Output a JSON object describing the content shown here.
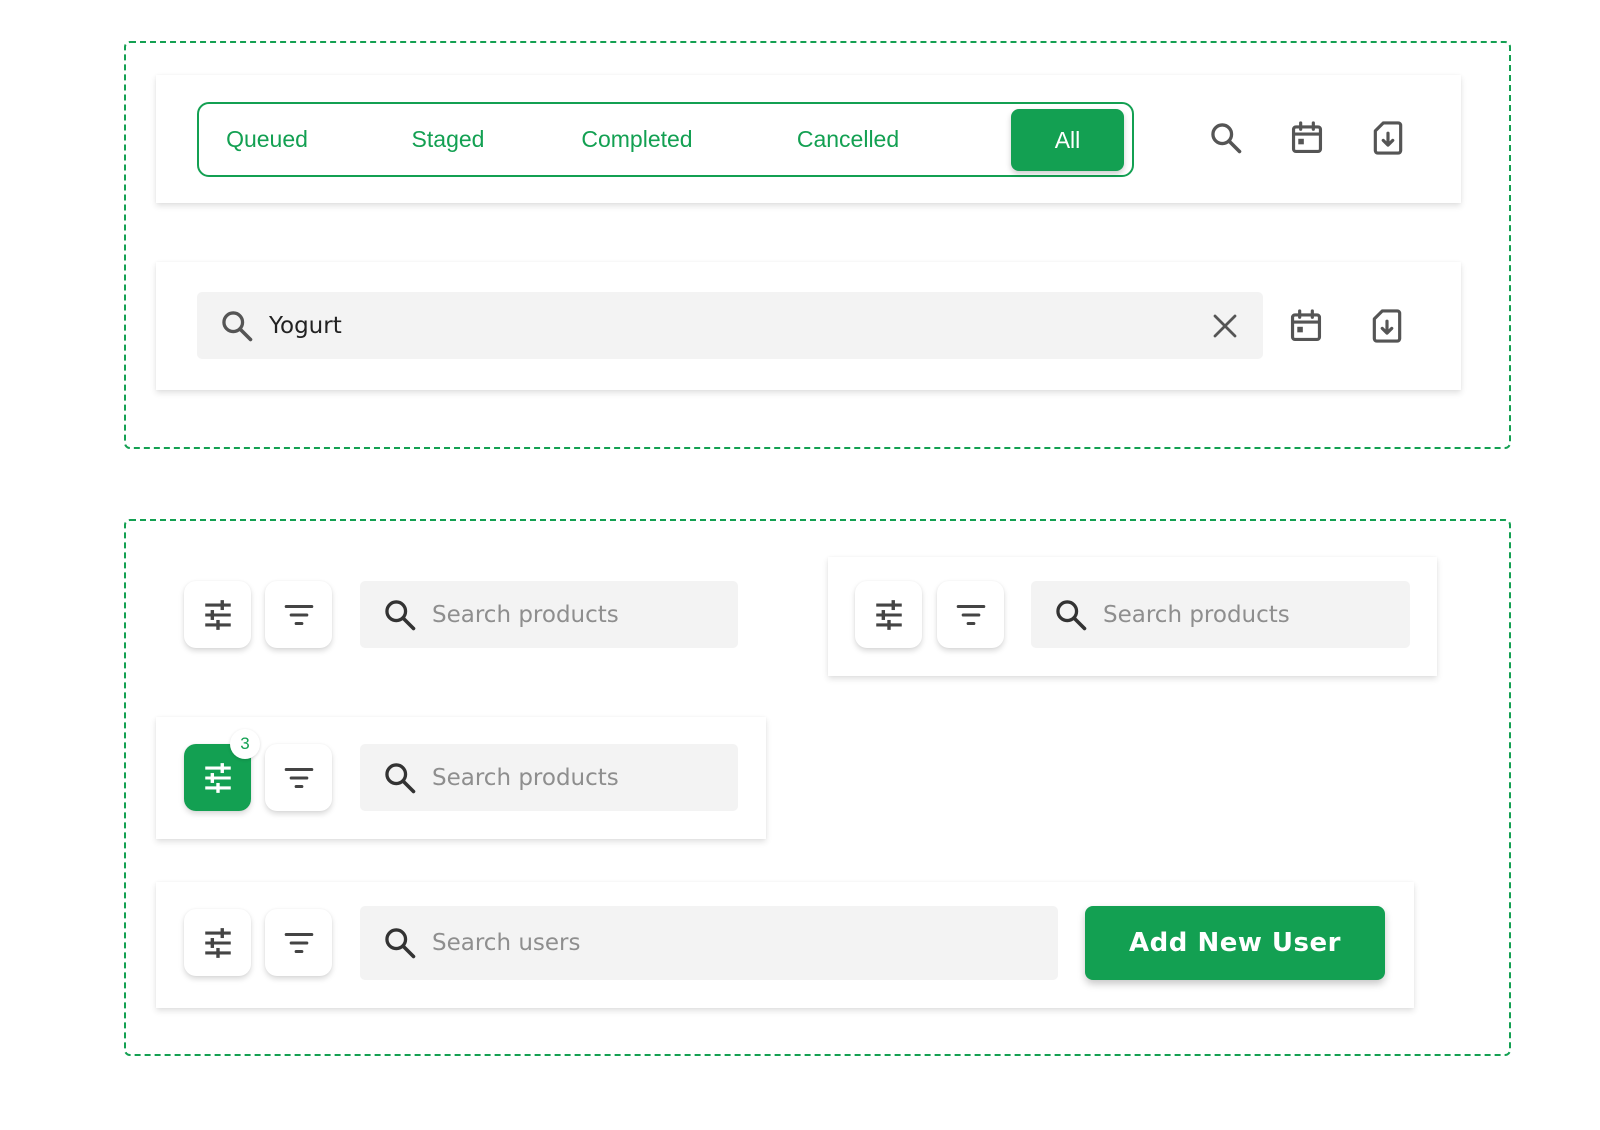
{
  "colors": {
    "accent": "#13a052",
    "icon": "#555555",
    "search_bg": "#f3f3f3"
  },
  "status_tabs": {
    "items": [
      {
        "label": "Queued"
      },
      {
        "label": "Staged"
      },
      {
        "label": "Completed"
      },
      {
        "label": "Cancelled"
      },
      {
        "label": "All",
        "active": true
      }
    ]
  },
  "toolbar_icons": [
    "search-icon",
    "calendar-icon",
    "download-file-icon"
  ],
  "search_bar": {
    "value": "Yogurt",
    "icons": [
      "search-icon",
      "close-icon",
      "calendar-icon",
      "download-file-icon"
    ]
  },
  "product_search_1": {
    "placeholder": "Search products"
  },
  "product_search_2": {
    "placeholder": "Search products"
  },
  "product_search_3": {
    "placeholder": "Search products",
    "filter_count": "3"
  },
  "user_search": {
    "placeholder": "Search users",
    "add_button_label": "Add New User"
  }
}
